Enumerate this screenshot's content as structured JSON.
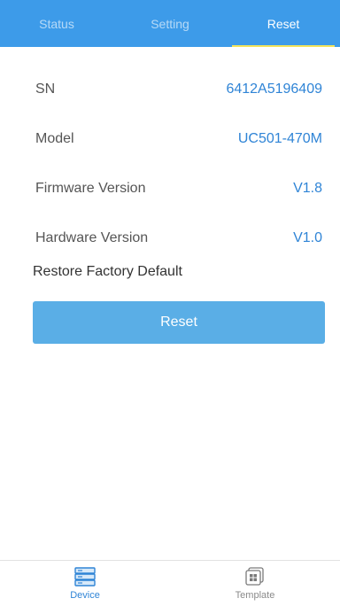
{
  "tabs": [
    {
      "label": "Status",
      "active": false
    },
    {
      "label": "Setting",
      "active": false
    },
    {
      "label": "Reset",
      "active": true
    }
  ],
  "info": [
    {
      "label": "SN",
      "value": "6412A5196409"
    },
    {
      "label": "Model",
      "value": "UC501-470M"
    },
    {
      "label": "Firmware Version",
      "value": "V1.8"
    },
    {
      "label": "Hardware Version",
      "value": "V1.0"
    }
  ],
  "restore": {
    "label": "Restore Factory Default",
    "button_label": "Reset"
  },
  "bottom_nav": [
    {
      "label": "Device",
      "icon": "device-icon",
      "active": true
    },
    {
      "label": "Template",
      "icon": "template-icon",
      "active": false
    }
  ],
  "colors": {
    "header_bg": "#3d9be9",
    "active_indicator": "#f3e35a",
    "value_text": "#2f84d6",
    "button_bg": "#5aaee6"
  }
}
